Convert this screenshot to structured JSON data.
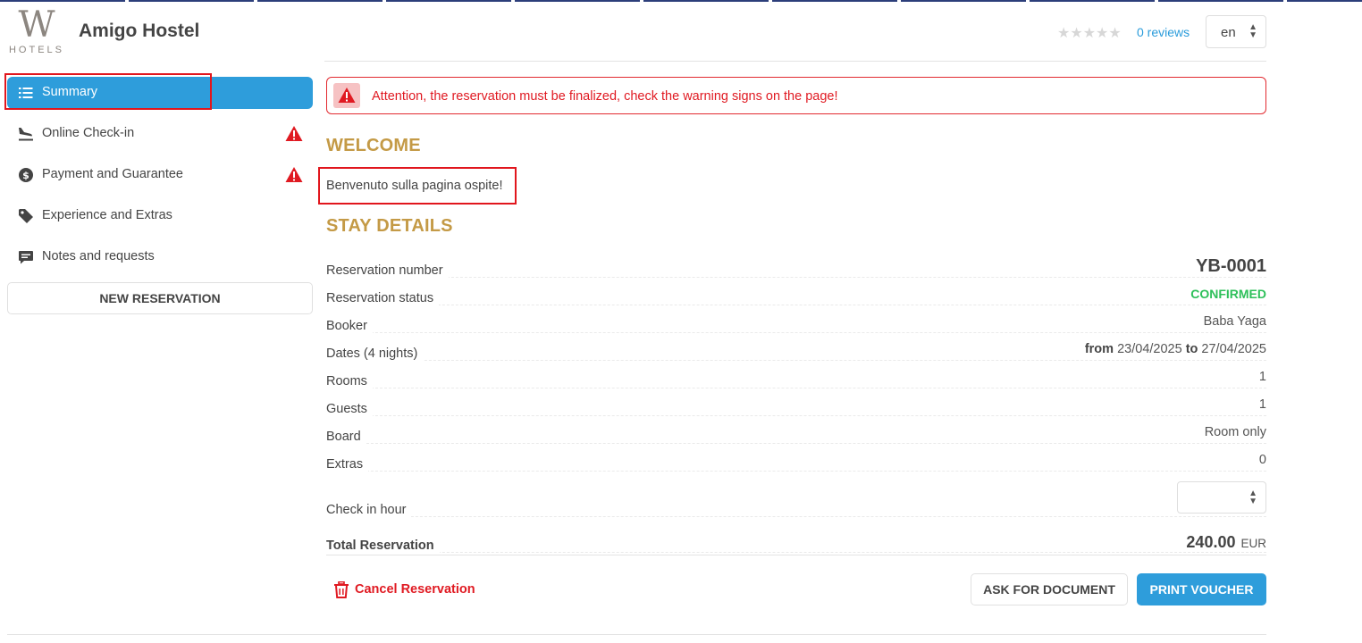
{
  "header": {
    "logo_letter": "W",
    "logo_sub": "HOTELS",
    "hotel_name": "Amigo Hostel",
    "stars": "★★★★★",
    "reviews_link": "0 reviews",
    "language": "en"
  },
  "sidebar": {
    "items": [
      {
        "label": "Summary",
        "icon": "list-icon",
        "active": true,
        "warning": false
      },
      {
        "label": "Online Check-in",
        "icon": "plane-landing-icon",
        "active": false,
        "warning": true
      },
      {
        "label": "Payment and Guarantee",
        "icon": "dollar-circle-icon",
        "active": false,
        "warning": true
      },
      {
        "label": "Experience and Extras",
        "icon": "tag-icon",
        "active": false,
        "warning": false
      },
      {
        "label": "Notes and requests",
        "icon": "comment-icon",
        "active": false,
        "warning": false
      }
    ],
    "new_reservation_label": "NEW RESERVATION"
  },
  "alert": {
    "text": "Attention, the reservation must be finalized, check the warning signs on the page!"
  },
  "welcome": {
    "title": "WELCOME",
    "text": "Benvenuto sulla pagina ospite!"
  },
  "stay_details": {
    "title": "STAY DETAILS",
    "reservation_number_label": "Reservation number",
    "reservation_number": "YB-0001",
    "status_label": "Reservation status",
    "status": "CONFIRMED",
    "booker_label": "Booker",
    "booker": "Baba Yaga",
    "dates_label": "Dates (4 nights)",
    "dates_from_word": "from",
    "date_from": "23/04/2025",
    "dates_to_word": "to",
    "date_to": "27/04/2025",
    "rooms_label": "Rooms",
    "rooms": "1",
    "guests_label": "Guests",
    "guests": "1",
    "board_label": "Board",
    "board": "Room only",
    "extras_label": "Extras",
    "extras": "0",
    "checkin_hour_label": "Check in hour",
    "checkin_hour_value": "",
    "total_label": "Total Reservation",
    "total_amount": "240.00",
    "total_currency": "EUR"
  },
  "actions": {
    "cancel_label": "Cancel Reservation",
    "ask_document_label": "ASK FOR DOCUMENT",
    "print_voucher_label": "PRINT VOUCHER"
  },
  "colors": {
    "accent_blue": "#2e9ddb",
    "section_gold": "#c49a46",
    "alert_red": "#e01a22",
    "confirmed_green": "#2ec05a"
  }
}
